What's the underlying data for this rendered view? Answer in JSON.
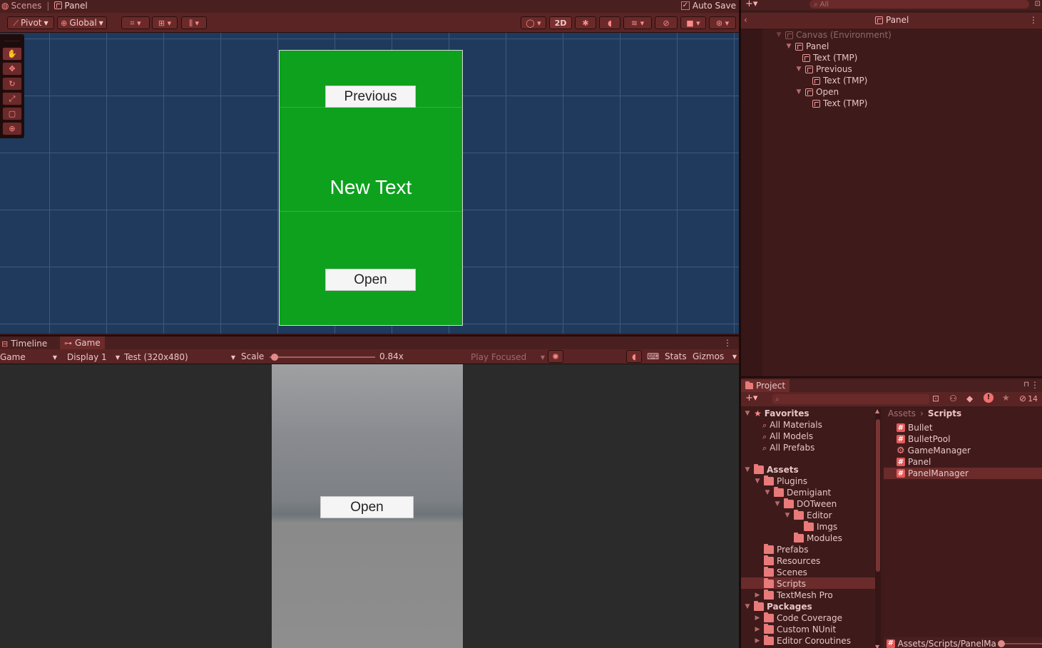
{
  "top": {
    "scenes_tab": "Scenes",
    "panel_tab": "Panel",
    "auto_save": "Auto Save"
  },
  "scene_toolbar": {
    "pivot": "Pivot",
    "global": "Global",
    "two_d": "2D"
  },
  "scene_view": {
    "previous_button": "Previous",
    "center_text": "New Text",
    "open_button": "Open",
    "panel_color": "#0ea11e"
  },
  "hierarchy": {
    "search_placeholder": "All",
    "header_title": "Panel",
    "items": [
      {
        "label": "Canvas (Environment)"
      },
      {
        "label": "Panel"
      },
      {
        "label": "Text (TMP)"
      },
      {
        "label": "Previous"
      },
      {
        "label": "Text (TMP)"
      },
      {
        "label": "Open"
      },
      {
        "label": "Text (TMP)"
      }
    ]
  },
  "game_tabs": {
    "timeline": "Timeline",
    "game": "Game"
  },
  "game_toolbar": {
    "view": "Game",
    "display": "Display 1",
    "resolution": "Test (320x480)",
    "scale_label": "Scale",
    "scale_value": "0.84x",
    "scale_fraction": 0.05,
    "play_focused": "Play Focused",
    "stats": "Stats",
    "gizmos": "Gizmos"
  },
  "game_view": {
    "open_button": "Open"
  },
  "project": {
    "tab": "Project",
    "hidden_count": "14",
    "favorites": {
      "title": "Favorites",
      "items": [
        "All Materials",
        "All Models",
        "All Prefabs"
      ]
    },
    "assets_title": "Assets",
    "tree": [
      {
        "label": "Plugins"
      },
      {
        "label": "Demigiant"
      },
      {
        "label": "DOTween"
      },
      {
        "label": "Editor"
      },
      {
        "label": "Imgs"
      },
      {
        "label": "Modules"
      },
      {
        "label": "Prefabs"
      },
      {
        "label": "Resources"
      },
      {
        "label": "Scenes"
      },
      {
        "label": "Scripts"
      },
      {
        "label": "TextMesh Pro"
      }
    ],
    "packages_title": "Packages",
    "packages": [
      "Code Coverage",
      "Custom NUnit",
      "Editor Coroutines"
    ],
    "breadcrumb": {
      "root": "Assets",
      "current": "Scripts"
    },
    "files": [
      {
        "label": "Bullet"
      },
      {
        "label": "BulletPool"
      },
      {
        "label": "GameManager"
      },
      {
        "label": "Panel"
      },
      {
        "label": "PanelManager"
      }
    ],
    "footer_path": "Assets/Scripts/PanelMa"
  }
}
